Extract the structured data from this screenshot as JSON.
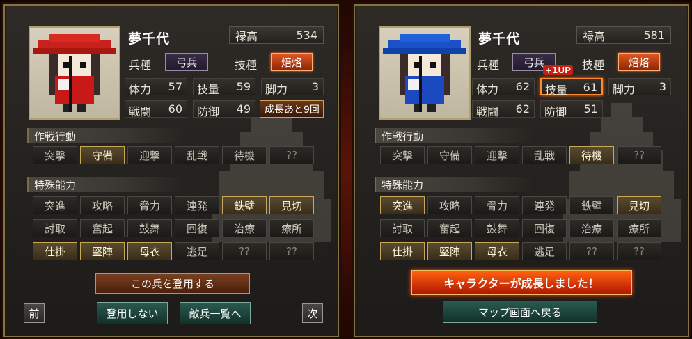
{
  "colors": {
    "accent_orange": "#e05a20",
    "active_gold": "#c8a858",
    "frame": "#8a7040"
  },
  "left": {
    "name": "夢千代",
    "salary_label": "禄高",
    "salary_value": "534",
    "unit_type_label": "兵種",
    "unit_type_value": "弓兵",
    "skill_label": "技種",
    "skill_value": "焙烙",
    "stats": [
      {
        "k": "体力",
        "v": "57"
      },
      {
        "k": "技量",
        "v": "59"
      },
      {
        "k": "脚力",
        "v": "3"
      },
      {
        "k": "戦闘",
        "v": "60"
      },
      {
        "k": "防御",
        "v": "49"
      }
    ],
    "growth_label": "成長あと9回",
    "section_tactics": "作戦行動",
    "tactics": [
      {
        "label": "突撃",
        "on": false
      },
      {
        "label": "守備",
        "on": true
      },
      {
        "label": "迎撃",
        "on": false
      },
      {
        "label": "乱戦",
        "on": false
      },
      {
        "label": "待機",
        "on": false
      },
      {
        "label": "??",
        "on": false
      }
    ],
    "section_abilities": "特殊能力",
    "abilities": [
      {
        "label": "突進",
        "on": false
      },
      {
        "label": "攻略",
        "on": false
      },
      {
        "label": "脅力",
        "on": false
      },
      {
        "label": "連発",
        "on": false
      },
      {
        "label": "鉄壁",
        "on": true
      },
      {
        "label": "見切",
        "on": true
      },
      {
        "label": "討取",
        "on": false
      },
      {
        "label": "奮起",
        "on": false
      },
      {
        "label": "鼓舞",
        "on": false
      },
      {
        "label": "回復",
        "on": false
      },
      {
        "label": "治療",
        "on": false
      },
      {
        "label": "療所",
        "on": false
      },
      {
        "label": "仕掛",
        "on": true
      },
      {
        "label": "堅陣",
        "on": true
      },
      {
        "label": "母衣",
        "on": true
      },
      {
        "label": "逃足",
        "on": false
      },
      {
        "label": "??",
        "on": false
      },
      {
        "label": "??",
        "on": false
      }
    ],
    "recruit_button": "この兵を登用する",
    "prev_button": "前",
    "decline_button": "登用しない",
    "enemy_list_button": "敵兵一覧へ",
    "next_button": "次"
  },
  "right": {
    "name": "夢千代",
    "salary_label": "禄高",
    "salary_value": "581",
    "unit_type_label": "兵種",
    "unit_type_value": "弓兵",
    "skill_label": "技種",
    "skill_value": "焙烙",
    "stats": [
      {
        "k": "体力",
        "v": "62"
      },
      {
        "k": "技量",
        "v": "61"
      },
      {
        "k": "脚力",
        "v": "3"
      },
      {
        "k": "戦闘",
        "v": "62"
      },
      {
        "k": "防御",
        "v": "51"
      }
    ],
    "level_up_popup": "+1UP",
    "section_tactics": "作戦行動",
    "tactics": [
      {
        "label": "突撃",
        "on": false
      },
      {
        "label": "守備",
        "on": false
      },
      {
        "label": "迎撃",
        "on": false
      },
      {
        "label": "乱戦",
        "on": false
      },
      {
        "label": "待機",
        "on": true
      },
      {
        "label": "??",
        "on": false
      }
    ],
    "section_abilities": "特殊能力",
    "abilities": [
      {
        "label": "突進",
        "on": true
      },
      {
        "label": "攻略",
        "on": false
      },
      {
        "label": "脅力",
        "on": false
      },
      {
        "label": "連発",
        "on": false
      },
      {
        "label": "鉄壁",
        "on": false
      },
      {
        "label": "見切",
        "on": true
      },
      {
        "label": "討取",
        "on": false
      },
      {
        "label": "奮起",
        "on": false
      },
      {
        "label": "鼓舞",
        "on": false
      },
      {
        "label": "回復",
        "on": false
      },
      {
        "label": "治療",
        "on": false
      },
      {
        "label": "療所",
        "on": false
      },
      {
        "label": "仕掛",
        "on": true
      },
      {
        "label": "堅陣",
        "on": true
      },
      {
        "label": "母衣",
        "on": true
      },
      {
        "label": "逃足",
        "on": false
      },
      {
        "label": "??",
        "on": false
      },
      {
        "label": "??",
        "on": false
      }
    ],
    "grown_banner": "キャラクターが成長しました！",
    "map_button": "マップ画面へ戻る"
  }
}
